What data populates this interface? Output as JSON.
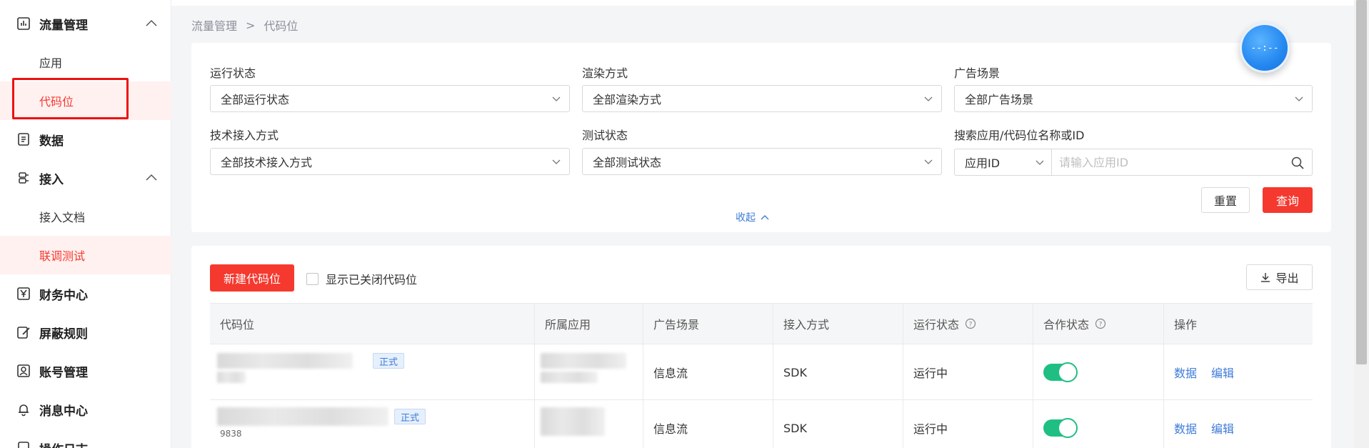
{
  "sidebar": {
    "groups": [
      {
        "label": "流量管理",
        "icon": "bar-chart-icon",
        "expanded": true
      },
      {
        "label": "数据",
        "icon": "document-list-icon"
      },
      {
        "label": "接入",
        "icon": "plug-icon",
        "expanded": true
      },
      {
        "label": "财务中心",
        "icon": "yen-icon"
      },
      {
        "label": "屏蔽规则",
        "icon": "block-edit-icon"
      },
      {
        "label": "账号管理",
        "icon": "user-card-icon"
      },
      {
        "label": "消息中心",
        "icon": "bell-icon"
      },
      {
        "label": "操作日志",
        "icon": "log-icon"
      }
    ],
    "subitems": [
      {
        "label": "应用"
      },
      {
        "label": "代码位",
        "active": true
      },
      {
        "label": "接入文档"
      },
      {
        "label": "联调测试",
        "active": true
      }
    ]
  },
  "breadcrumb": {
    "parent": "流量管理",
    "separator": ">",
    "current": "代码位"
  },
  "filters": {
    "run_status": {
      "label": "运行状态",
      "value": "全部运行状态"
    },
    "render_mode": {
      "label": "渲染方式",
      "value": "全部渲染方式"
    },
    "ad_scene": {
      "label": "广告场景",
      "value": "全部广告场景"
    },
    "tech_access": {
      "label": "技术接入方式",
      "value": "全部技术接入方式"
    },
    "test_status": {
      "label": "测试状态",
      "value": "全部测试状态"
    },
    "search": {
      "label": "搜索应用/代码位名称或ID",
      "type_value": "应用ID",
      "placeholder": "请输入应用ID"
    },
    "reset_label": "重置",
    "query_label": "查询",
    "collapse_label": "收起"
  },
  "floating_ball": {
    "text": "--:--"
  },
  "toolbar": {
    "new_label": "新建代码位",
    "show_closed_label": "显示已关闭代码位",
    "export_label": "导出"
  },
  "table": {
    "columns": [
      "代码位",
      "所属应用",
      "广告场景",
      "接入方式",
      "运行状态",
      "合作状态",
      "操作"
    ],
    "rows": [
      {
        "badge": "正式",
        "scene": "信息流",
        "access": "SDK",
        "status": "运行中",
        "coop_on": true,
        "action_data": "数据",
        "action_edit": "编辑"
      },
      {
        "badge": "正式",
        "id_fragment": "9838",
        "scene": "信息流",
        "access": "SDK",
        "status": "运行中",
        "coop_on": true,
        "action_data": "数据",
        "action_edit": "编辑"
      }
    ]
  },
  "colors": {
    "accent": "#f5392f",
    "link": "#3e7bd8",
    "toggle_on": "#1fbf83"
  }
}
